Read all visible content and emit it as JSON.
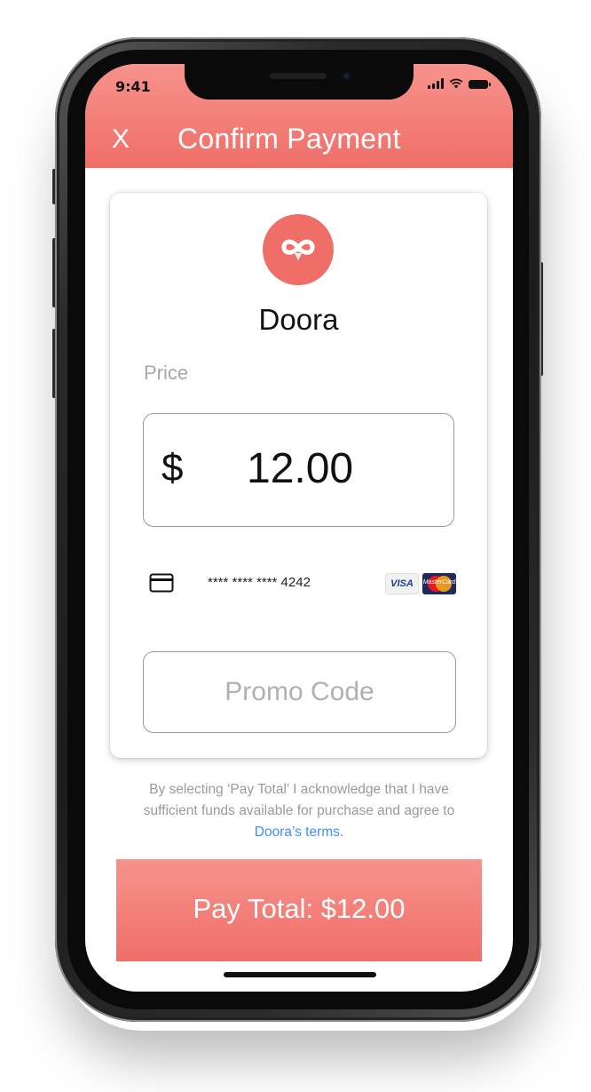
{
  "status_bar": {
    "time": "9:41"
  },
  "header": {
    "close_label": "X",
    "title": "Confirm Payment"
  },
  "merchant": {
    "logo_icon": "infinity-icon",
    "name": "Doora"
  },
  "price": {
    "label": "Price",
    "currency": "$",
    "amount": "12.00"
  },
  "payment_method": {
    "card_icon": "credit-card-icon",
    "card_number": "**** **** **** 4242",
    "brands": [
      "VISA",
      "MasterCard"
    ]
  },
  "promo": {
    "placeholder": "Promo Code"
  },
  "disclaimer": {
    "text": "By selecting ‘Pay Total’ I acknowledge that I have sufficient funds available for purchase and agree to ",
    "link": "Doora’s terms."
  },
  "pay_button": {
    "label": "Pay Total: $12.00"
  },
  "colors": {
    "accent": "#f06e68",
    "link": "#3f8ef2"
  }
}
